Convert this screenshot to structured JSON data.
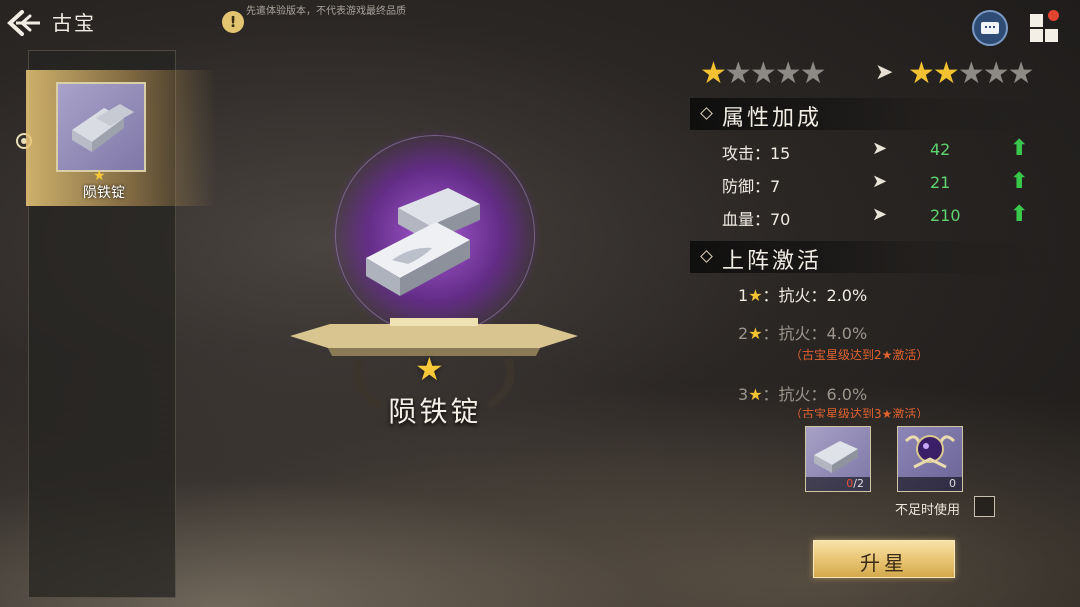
{
  "header": {
    "title": "古宝",
    "disclaimer": "先遣体验版本，不代表游戏最终品质",
    "warn_icon": "exclamation-icon",
    "chat_icon": "chat-icon",
    "menu_icon": "grid-menu-icon"
  },
  "list": {
    "items": [
      {
        "name": "陨铁锭",
        "stars": 1,
        "icon": "iron-ingot-icon"
      }
    ]
  },
  "showcase": {
    "name": "陨铁锭",
    "stars": 1
  },
  "star_upgrade": {
    "current_stars": 1,
    "next_stars": 2,
    "max_stars": 5
  },
  "attributes": {
    "heading": "属性加成",
    "rows": [
      {
        "label": "攻击：15",
        "next": "42"
      },
      {
        "label": "防御：7",
        "next": "21"
      },
      {
        "label": "血量：70",
        "next": "210"
      }
    ]
  },
  "activation": {
    "heading": "上阵激活",
    "rows": [
      {
        "num": "1",
        "text": "：抗火：2.0%",
        "active": true,
        "note": ""
      },
      {
        "num": "2",
        "text": "：抗火：4.0%",
        "active": false,
        "note": "（古宝星级达到2★激活）"
      },
      {
        "num": "3",
        "text": "：抗火：6.0%",
        "active": false,
        "note": "（古宝星级达到3★激活）"
      }
    ]
  },
  "materials": [
    {
      "icon": "iron-ingot-icon",
      "have": "0",
      "need": "/2"
    },
    {
      "icon": "purple-orb-crest-icon",
      "count": "0"
    }
  ],
  "controls": {
    "use_when_insufficient": "不足时使用",
    "upgrade_button": "升星"
  },
  "colors": {
    "star_on": "#f2c233",
    "star_off": "#8d8a86",
    "value_green": "#5fd36f",
    "note_red": "#e0622f",
    "halo_purple": "#8a3cc0"
  }
}
